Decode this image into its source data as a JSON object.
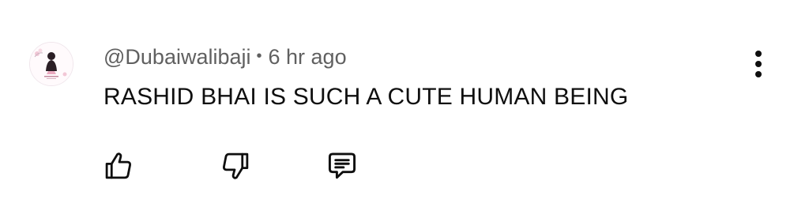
{
  "comment": {
    "author": "@Dubaiwalibaji",
    "separator": "•",
    "time": "6 hr ago",
    "text": "RASHID BHAI IS SUCH A CUTE HUMAN BEING"
  },
  "icons": {
    "avatar": "profile-avatar",
    "more": "more-vertical-icon",
    "like": "thumbs-up-icon",
    "dislike": "thumbs-down-icon",
    "reply": "reply-comment-icon"
  },
  "colors": {
    "meta": "#606060",
    "text": "#0f0f0f",
    "icon": "#0f0f0f",
    "background": "#ffffff"
  }
}
